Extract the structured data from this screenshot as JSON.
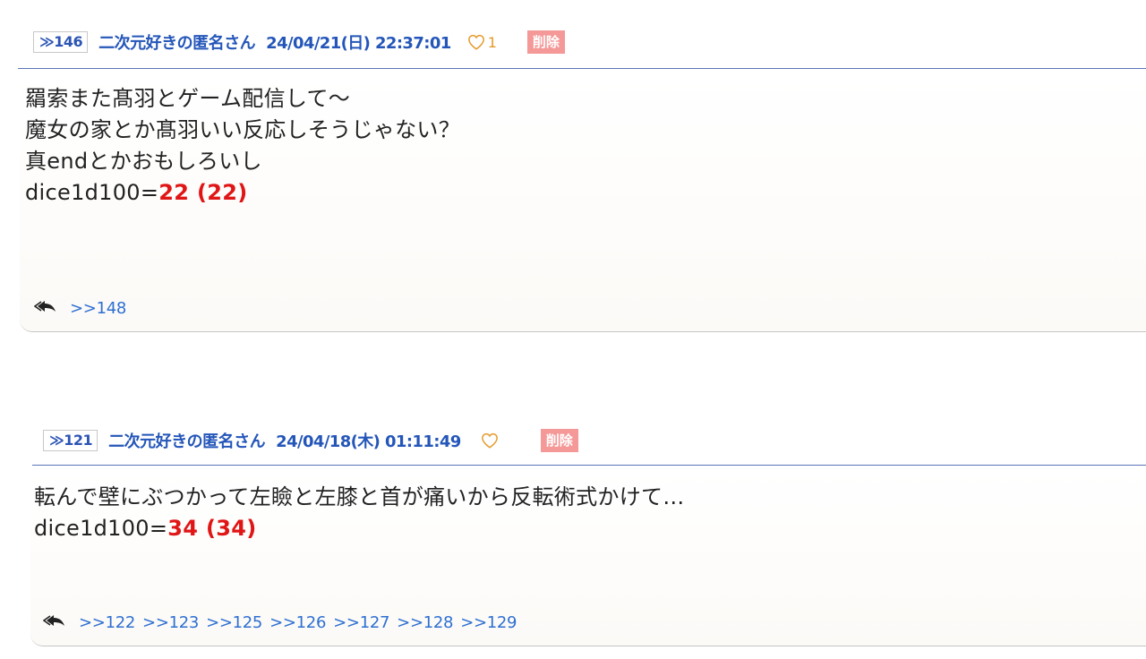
{
  "posts": [
    {
      "res_no": "≫146",
      "author": "二次元好きの匿名さん",
      "date": "24/04/21(日) 22:37:01",
      "likes": "1",
      "delete_label": "削除",
      "lines": [
        "羂索また髙羽とゲーム配信して〜",
        "魔女の家とか髙羽いい反応しそうじゃない？",
        "真endとかおもしろいし"
      ],
      "dice_prefix": "dice1d100=",
      "dice_value": "22 (22)",
      "replies": [
        ">>148"
      ]
    },
    {
      "res_no": "≫121",
      "author": "二次元好きの匿名さん",
      "date": "24/04/18(木) 01:11:49",
      "likes": "",
      "delete_label": "削除",
      "lines": [
        "転んで壁にぶつかって左瞼と左膝と首が痛いから反転術式かけて…"
      ],
      "dice_prefix": "dice1d100=",
      "dice_value": "34 (34)",
      "replies": [
        ">>122",
        ">>123",
        ">>125",
        ">>126",
        ">>127",
        ">>128",
        ">>129"
      ]
    }
  ],
  "colors": {
    "link": "#2456b9",
    "dice": "#e01515",
    "heart": "#e59a2c",
    "delete_bg": "#f59898"
  },
  "icons": {
    "like": "heart-outline-icon",
    "replies": "reply-all-icon"
  }
}
